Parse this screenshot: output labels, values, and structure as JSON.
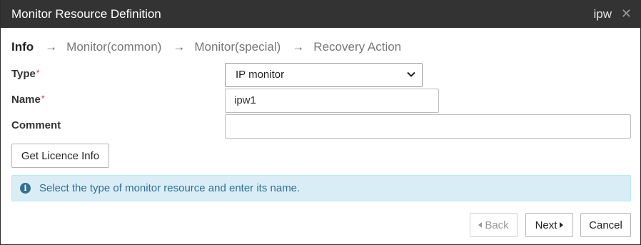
{
  "titlebar": {
    "title": "Monitor Resource Definition",
    "resource": "ipw",
    "close_glyph": "✕"
  },
  "steps": [
    {
      "label": "Info",
      "active": true
    },
    {
      "label": "Monitor(common)",
      "active": false
    },
    {
      "label": "Monitor(special)",
      "active": false
    },
    {
      "label": "Recovery Action",
      "active": false
    }
  ],
  "step_arrow": "→",
  "form": {
    "type_label": "Type",
    "type_value": "IP monitor",
    "name_label": "Name",
    "name_value": "ipw1",
    "comment_label": "Comment",
    "comment_value": "",
    "required_mark": "*"
  },
  "buttons": {
    "licence": "Get Licence Info",
    "back": "Back",
    "next": "Next",
    "cancel": "Cancel"
  },
  "alert": {
    "icon_glyph": "i",
    "message": "Select the type of monitor resource and enter its name."
  },
  "colors": {
    "titlebar_bg": "#333333",
    "alert_bg": "#d9edf7",
    "alert_text": "#31708f",
    "required": "#c0392b"
  }
}
